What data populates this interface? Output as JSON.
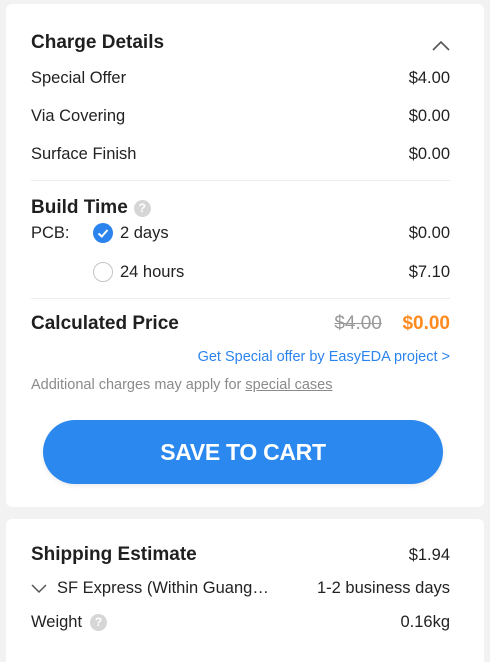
{
  "charge_details": {
    "title": "Charge Details",
    "items": [
      {
        "label": "Special Offer",
        "value": "$4.00"
      },
      {
        "label": "Via Covering",
        "value": "$0.00"
      },
      {
        "label": "Surface Finish",
        "value": "$0.00"
      }
    ]
  },
  "build_time": {
    "title": "Build Time",
    "help_glyph": "?",
    "prefix": "PCB:",
    "options": [
      {
        "label": "2 days",
        "price": "$0.00",
        "selected": true
      },
      {
        "label": "24 hours",
        "price": "$7.10",
        "selected": false
      }
    ]
  },
  "calculated_price": {
    "label": "Calculated Price",
    "old_price": "$4.00",
    "new_price": "$0.00",
    "new_price_color": "#ff8a1e"
  },
  "special_offer_link": "Get Special offer by EasyEDA project >",
  "note": {
    "text": "Additional charges may apply for ",
    "link": "special cases"
  },
  "cta": {
    "label": "SAVE TO CART",
    "color": "#2b88ee"
  },
  "shipping": {
    "title": "Shipping Estimate",
    "price": "$1.94",
    "carrier": "SF Express (Within Guang…",
    "delivery": "1-2 business days",
    "weight_label": "Weight",
    "weight_value": "0.16kg",
    "help_glyph": "?"
  },
  "icons": {
    "collapse": "chevron-up-icon",
    "expand": "chevron-down-icon",
    "help": "question-icon",
    "check": "check-icon"
  }
}
